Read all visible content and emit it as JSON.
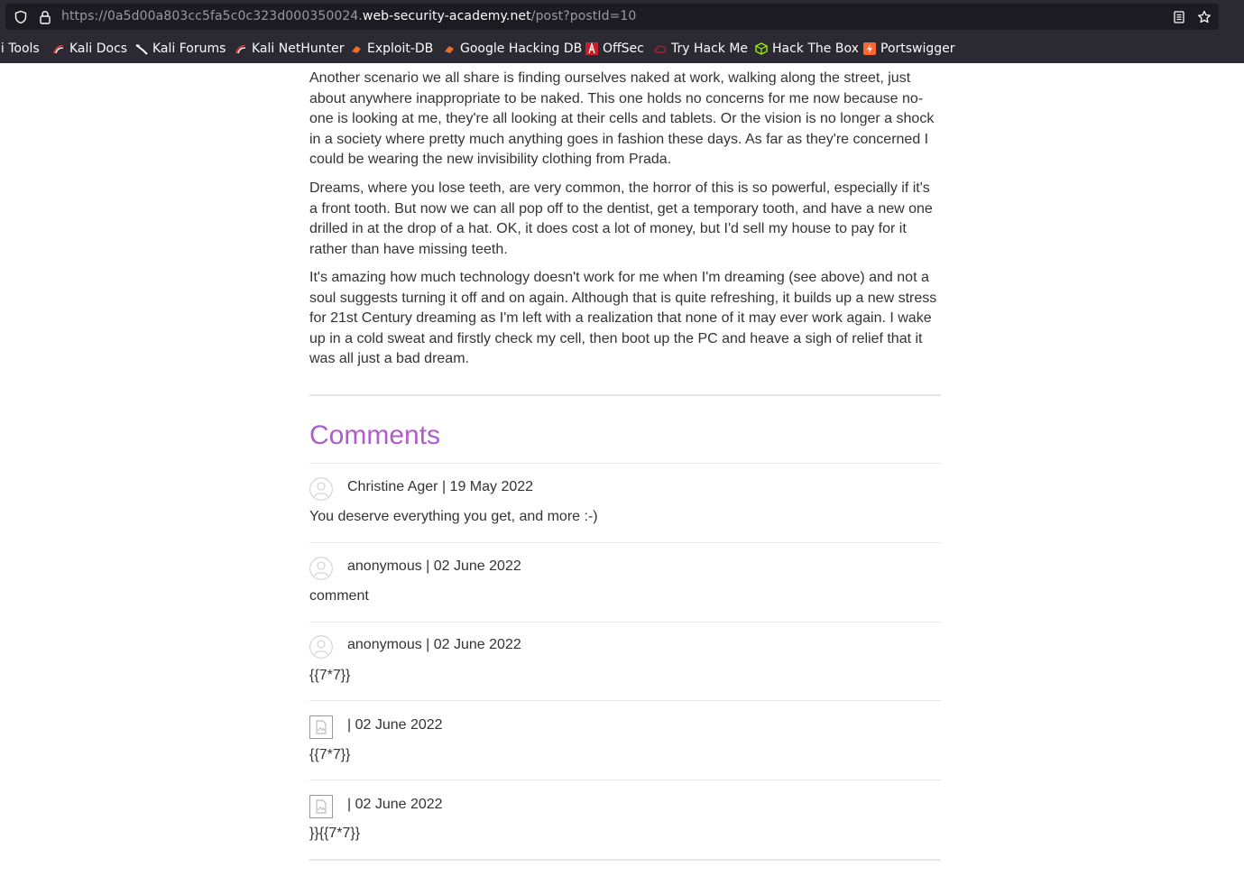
{
  "browser": {
    "url_prefix": "https://0a5d00a803cc5fa5c0c323d000350024.",
    "url_domain": "web-security-academy.net",
    "url_path": "/post?postId=10",
    "bookmarks": [
      {
        "label": "li Tools",
        "icon": "kali-icon"
      },
      {
        "label": "Kali Docs",
        "icon": "kali-docs-icon"
      },
      {
        "label": "Kali Forums",
        "icon": "kali-forums-icon"
      },
      {
        "label": "Kali NetHunter",
        "icon": "kali-nethunter-icon"
      },
      {
        "label": "Exploit-DB",
        "icon": "exploit-db-icon"
      },
      {
        "label": "Google Hacking DB",
        "icon": "google-hacking-db-icon"
      },
      {
        "label": "OffSec",
        "icon": "offsec-icon"
      },
      {
        "label": "Try Hack Me",
        "icon": "tryhackme-icon"
      },
      {
        "label": "Hack The Box",
        "icon": "hackthebox-icon"
      },
      {
        "label": "Portswigger",
        "icon": "portswigger-icon"
      }
    ]
  },
  "post": {
    "paragraphs": [
      "Another scenario we all share is finding ourselves naked at work, walking along the street, just about anywhere inappropriate to be naked. This one holds no concerns for me now because no-one is looking at me, they're all looking at their cells and tablets. Or the vision is no longer a shock in a society where pretty much anything goes in fashion these days. As far as they're concerned I could be wearing the new invisibility clothing from Prada.",
      "Dreams, where you lose teeth, are very common, the horror of this is so powerful, especially if it's a front tooth. But now we can all pop off to the dentist, get a temporary tooth, and have a new one drilled in at the drop of a hat. OK, it does cost a lot of money, but I'd sell my house to pay for it rather than have missing teeth.",
      "It's amazing how much technology doesn't work for me when I'm dreaming (see above) and not a soul suggests turning it off and on again. Although that is quite refreshing, it builds up a new stress for 21st Century dreaming as I'm left with a realization that none of it may ever work again. I wake up in a cold sweat and firstly check my cell, then boot up the PC and heave a sigh of relief that it was all just a bad dream."
    ]
  },
  "comments": {
    "title": "Comments",
    "accent_color": "#b05ccc",
    "items": [
      {
        "meta": "Christine Ager | 19 May 2022",
        "body": "You deserve everything you get, and more :-)",
        "avatar": "default-avatar-icon"
      },
      {
        "meta": "anonymous | 02 June 2022",
        "body": "comment",
        "avatar": "default-avatar-icon"
      },
      {
        "meta": "anonymous | 02 June 2022",
        "body": "{{7*7}}",
        "avatar": "default-avatar-icon"
      },
      {
        "meta": "| 02 June 2022",
        "body": "{{7*7}}",
        "avatar": "broken-image-icon"
      },
      {
        "meta": "| 02 June 2022",
        "body": "}}{{7*7}}",
        "avatar": "broken-image-icon"
      }
    ]
  }
}
